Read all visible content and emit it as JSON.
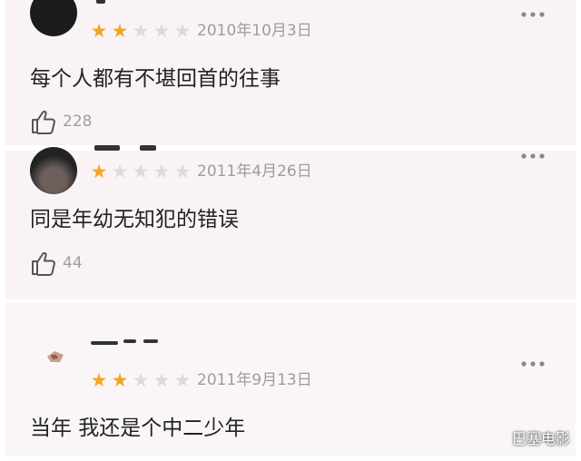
{
  "reviews": [
    {
      "rating": 2,
      "max_rating": 5,
      "date": "2010年10月3日",
      "comment": "每个人都有不堪回首的往事",
      "likes": "228"
    },
    {
      "rating": 1,
      "max_rating": 5,
      "date": "2011年4月26日",
      "comment": "同是年幼无知犯的错误",
      "likes": "44"
    },
    {
      "rating": 2,
      "max_rating": 5,
      "date": "2011年9月13日",
      "comment": "当年 我还是个中二少年",
      "likes": ""
    }
  ],
  "watermark": "巴塞电影",
  "colors": {
    "star_on": "#f4a524",
    "star_off": "#dadada",
    "card_bg": "#f9f3f5",
    "text_muted": "#9c9c9c"
  },
  "icons": [
    "more-dots-icon",
    "thumbs-up-icon",
    "star-icon"
  ]
}
